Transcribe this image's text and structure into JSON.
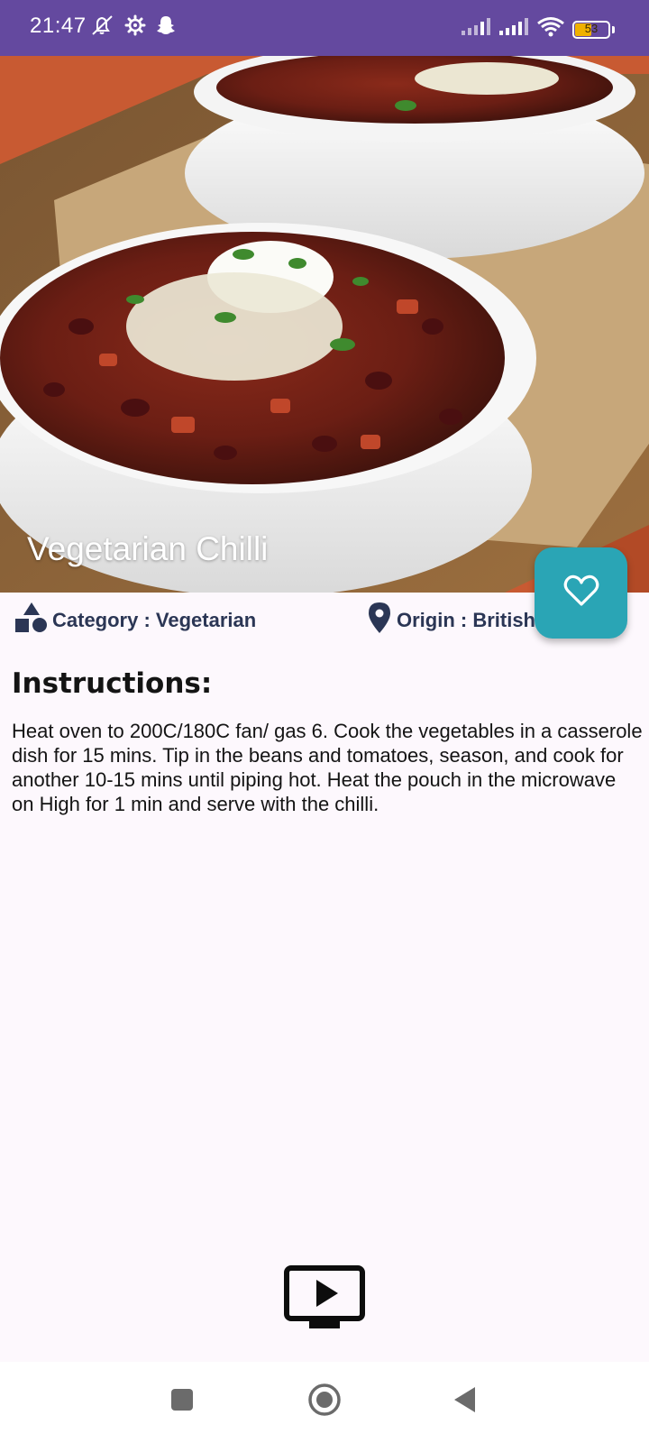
{
  "status_bar": {
    "time": "21:47",
    "battery_level": "53",
    "battery_fraction": 0.53,
    "background": "#64499f",
    "left_icons": [
      "mute-icon",
      "settings-icon",
      "snapchat-icon"
    ],
    "right_icons": [
      "signal-icon",
      "signal-icon",
      "wifi-icon",
      "battery-icon"
    ]
  },
  "recipe": {
    "title": "Vegetarian Chilli",
    "category": "Category : Vegetarian",
    "origin": "Origin : British",
    "instructions_heading": "Instructions:",
    "instructions": "Heat oven to 200C/180C fan/ gas 6. Cook the vegetables in a casserole dish for 15 mins. Tip in the beans and tomatoes, season, and cook for another 10-15 mins until piping hot. Heat the pouch in the microwave on High for 1 min and serve with the chilli."
  },
  "icons": {
    "favorite": "heart-icon",
    "category": "shapes-icon",
    "origin": "location-pin-icon",
    "video": "video-play-icon"
  },
  "colors": {
    "accent": "#2aa5b5",
    "meta_text": "#2b3655",
    "background": "#fdf8fd"
  },
  "nav_bar": {
    "buttons": [
      "recents-button",
      "home-button",
      "back-button"
    ]
  }
}
